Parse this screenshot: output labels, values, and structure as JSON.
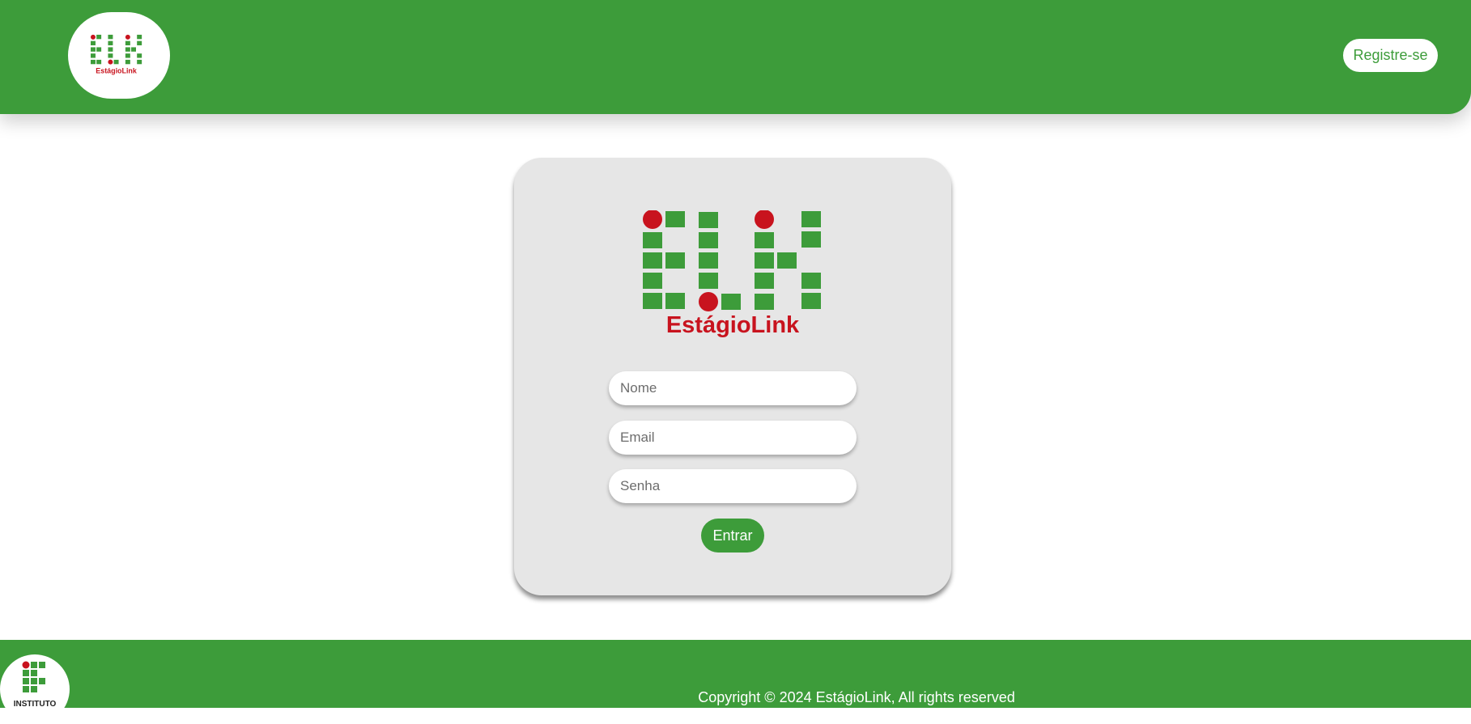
{
  "header": {
    "logo_text": "EstágioLink",
    "register_label": "Registre-se"
  },
  "login_card": {
    "logo_text": "EstágioLink",
    "name_placeholder": "Nome",
    "email_placeholder": "Email",
    "password_placeholder": "Senha",
    "submit_label": "Entrar"
  },
  "footer": {
    "institution_logo_text": "INSTITUTO",
    "copyright": "Copyright © 2024 EstágioLink, All rights reserved"
  },
  "colors": {
    "brand_green": "#3d9c3a",
    "brand_red": "#c8131e",
    "card_background": "#e6e6e6"
  }
}
